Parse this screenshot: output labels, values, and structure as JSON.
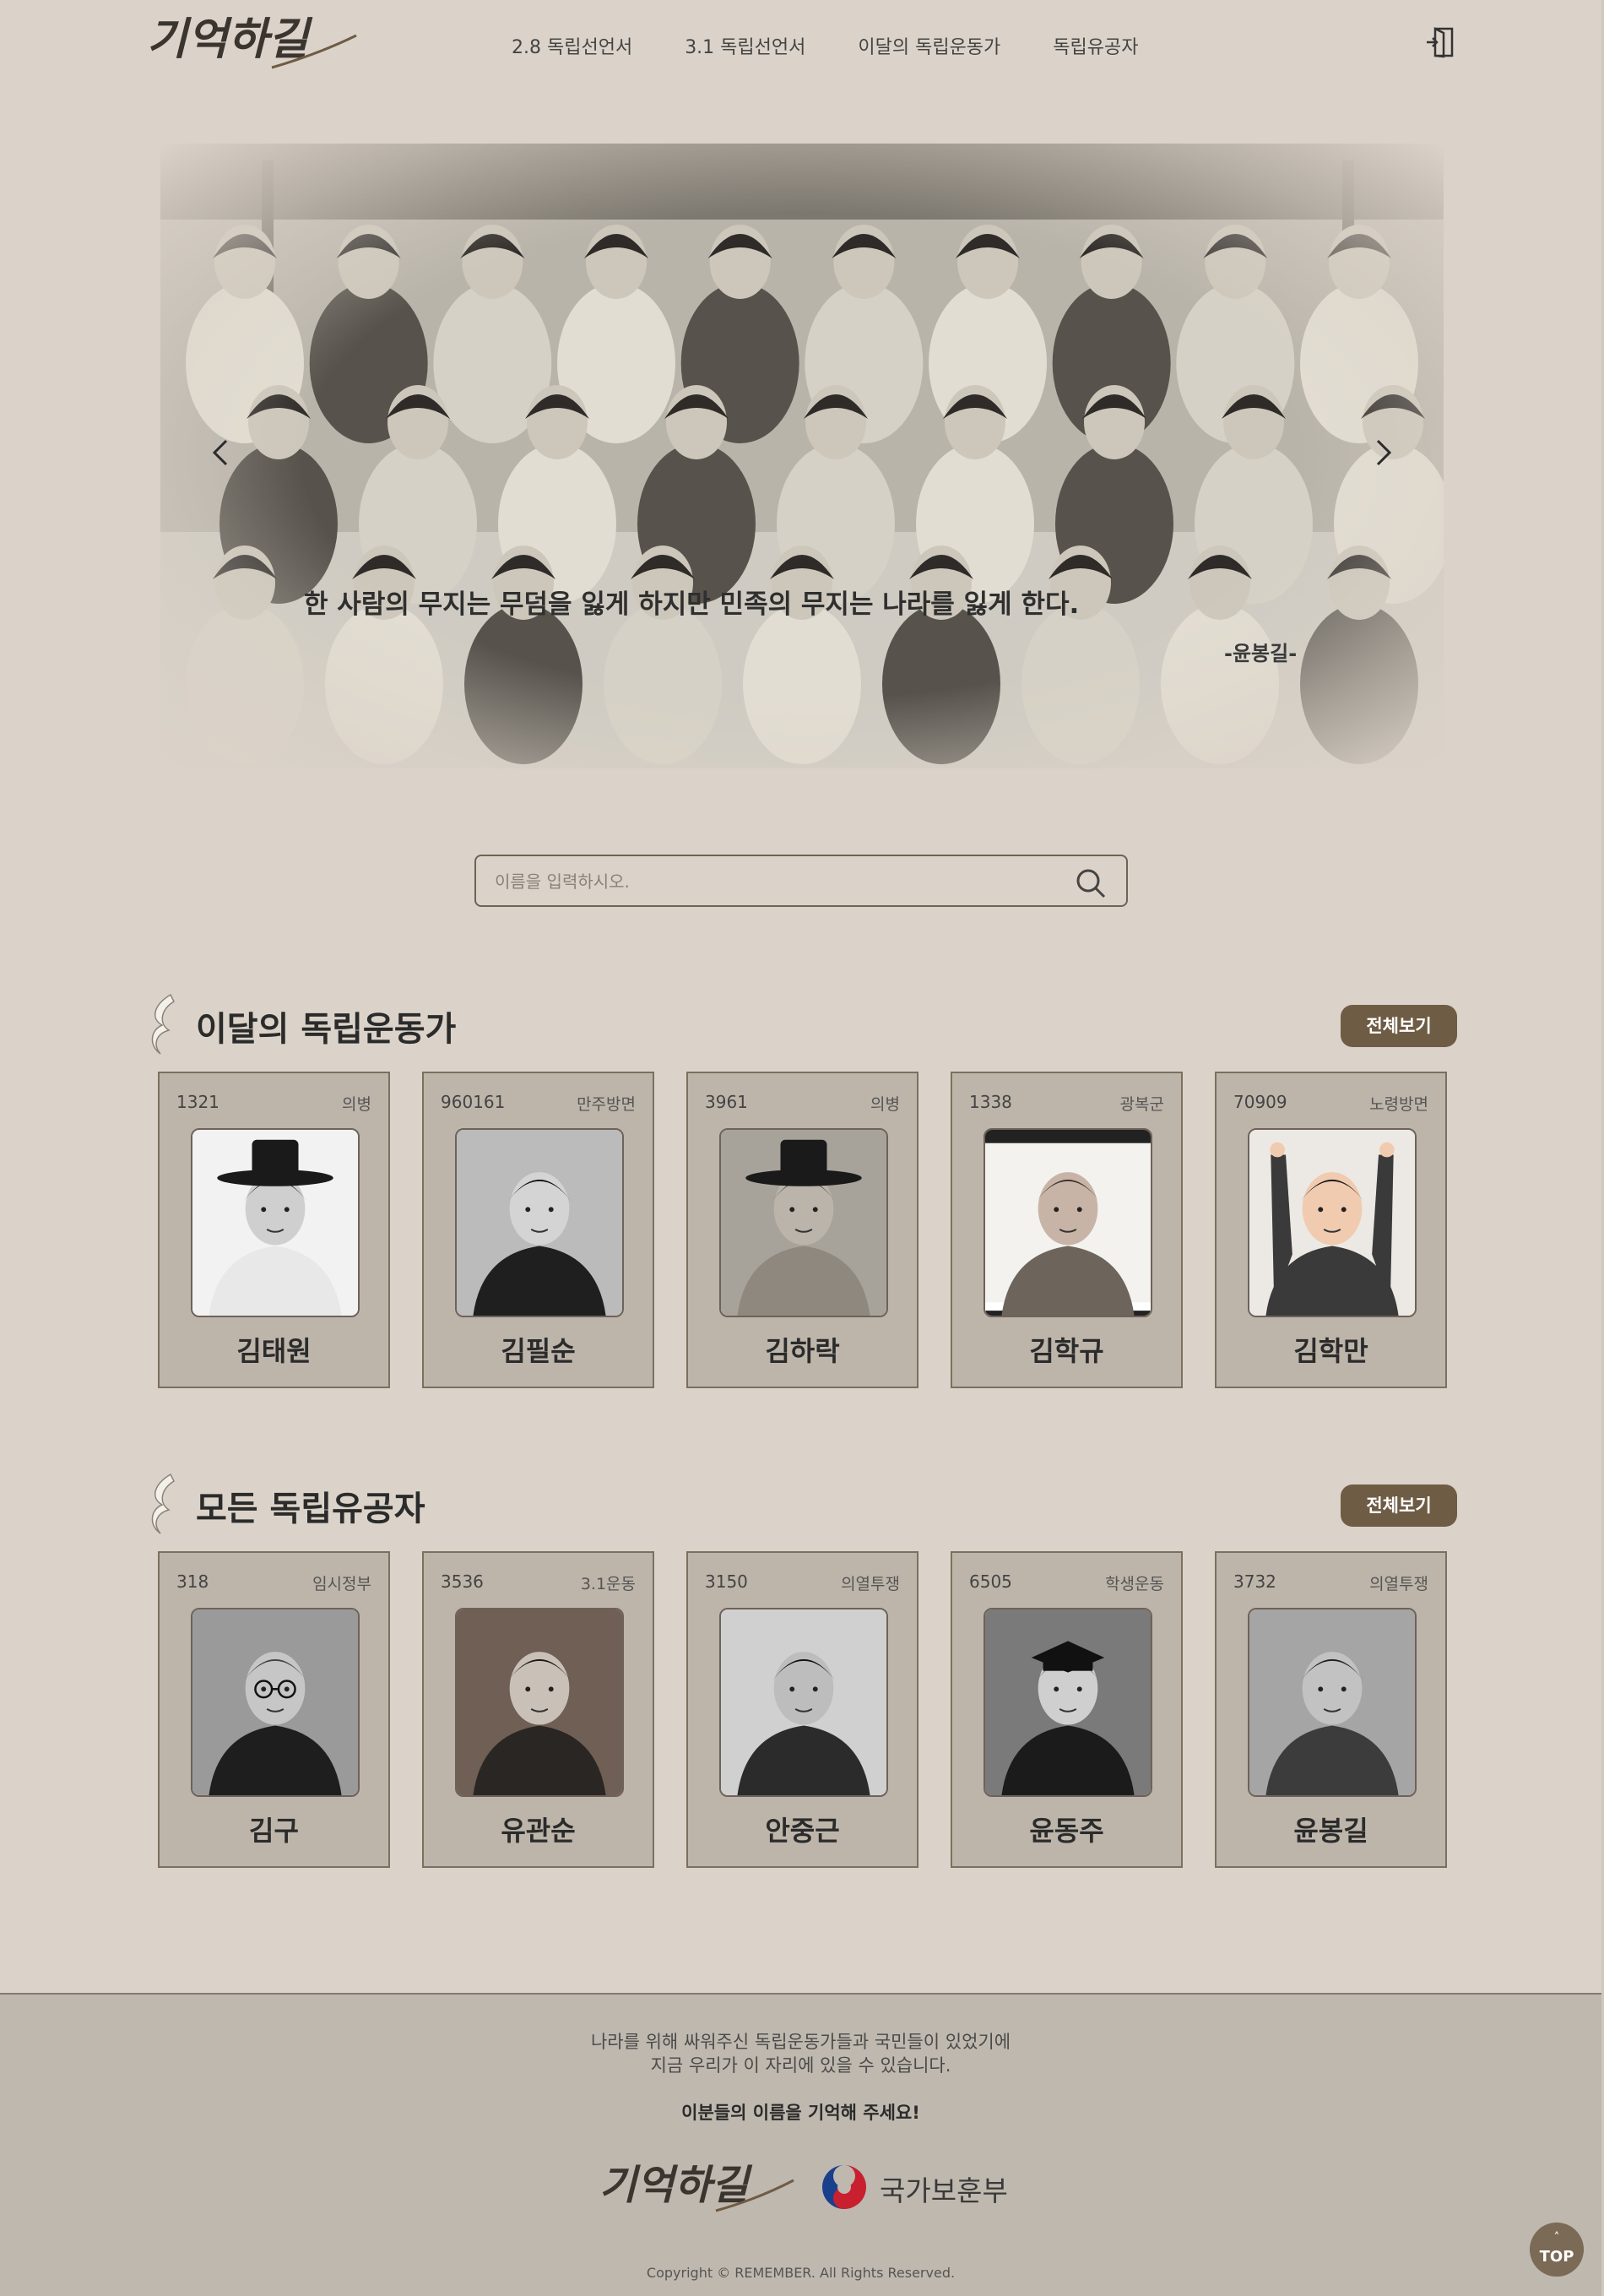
{
  "header": {
    "logo_text": "기억하길",
    "nav": [
      "2.8 독립선언서",
      "3.1 독립선언서",
      "이달의 독립운동가",
      "독립유공자"
    ],
    "login_icon": "login-door-icon"
  },
  "hero": {
    "quote": "한 사람의 무지는 무덤을 잃게 하지만 민족의 무지는 나라를 잃게 한다.",
    "author": "-윤봉길-",
    "slide_count": 5,
    "active_slide": 1
  },
  "search": {
    "placeholder": "이름을 입력하시오.",
    "value": "",
    "icon": "search-icon"
  },
  "sections": [
    {
      "title": "이달의 독립운동가",
      "button": "전체보기",
      "cards": [
        {
          "id": "1321",
          "category": "의병",
          "name": "김태원"
        },
        {
          "id": "960161",
          "category": "만주방면",
          "name": "김필순"
        },
        {
          "id": "3961",
          "category": "의병",
          "name": "김하락"
        },
        {
          "id": "1338",
          "category": "광복군",
          "name": "김학규"
        },
        {
          "id": "70909",
          "category": "노령방면",
          "name": "김학만"
        }
      ]
    },
    {
      "title": "모든 독립유공자",
      "button": "전체보기",
      "cards": [
        {
          "id": "318",
          "category": "임시정부",
          "name": "김구"
        },
        {
          "id": "3536",
          "category": "3.1운동",
          "name": "유관순"
        },
        {
          "id": "3150",
          "category": "의열투쟁",
          "name": "안중근"
        },
        {
          "id": "6505",
          "category": "학생운동",
          "name": "윤동주"
        },
        {
          "id": "3732",
          "category": "의열투쟁",
          "name": "윤봉길"
        }
      ]
    }
  ],
  "footer": {
    "line1": "나라를 위해 싸워주신 독립운동가들과 국민들이 있었기에",
    "line2": "지금 우리가 이 자리에 있을 수 있습니다.",
    "strong": "이분들의 이름을 기억해 주세요!",
    "logo_text": "기억하길",
    "gov_name": "국가보훈부",
    "copyright": "Copyright © REMEMBER. All Rights Reserved."
  },
  "top_button": {
    "arrow": "˄",
    "label": "TOP"
  },
  "colors": {
    "background": "#dbd3c9",
    "accent": "#6e5c44",
    "card": "#bdb5aa",
    "footer": "#bfb8ae"
  }
}
